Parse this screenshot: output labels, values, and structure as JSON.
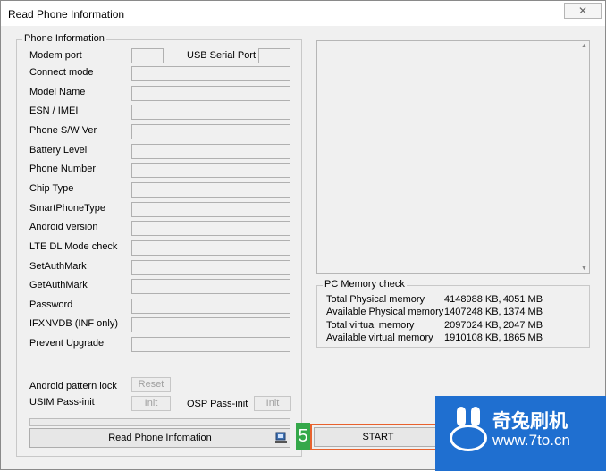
{
  "window": {
    "title": "Read Phone Information",
    "close_glyph": "✕"
  },
  "info_group": {
    "legend": "Phone Information",
    "modem_port_label": "Modem port",
    "usb_serial_port_label": "USB Serial Port",
    "fields": [
      {
        "label": "Connect mode",
        "value": ""
      },
      {
        "label": "Model Name",
        "value": ""
      },
      {
        "label": "ESN / IMEI",
        "value": ""
      },
      {
        "label": "Phone S/W Ver",
        "value": ""
      },
      {
        "label": "Battery Level",
        "value": ""
      },
      {
        "label": "Phone Number",
        "value": ""
      },
      {
        "label": "Chip Type",
        "value": ""
      },
      {
        "label": "SmartPhoneType",
        "value": ""
      },
      {
        "label": "Android version",
        "value": ""
      },
      {
        "label": "LTE DL Mode check",
        "value": ""
      },
      {
        "label": "SetAuthMark",
        "value": ""
      },
      {
        "label": "GetAuthMark",
        "value": ""
      },
      {
        "label": "Password",
        "value": ""
      },
      {
        "label": "IFXNVDB (INF only)",
        "value": ""
      },
      {
        "label": "Prevent Upgrade",
        "value": ""
      }
    ],
    "android_pattern_lock_label": "Android pattern lock",
    "reset_label": "Reset",
    "usim_pass_init_label": "USIM Pass-init",
    "usim_init_label": "Init",
    "osp_pass_init_label": "OSP Pass-init",
    "osp_init_label": "Init"
  },
  "actions": {
    "read_label": "Read Phone Infomation",
    "start_label": "START",
    "step_number": "5"
  },
  "memory": {
    "legend": "PC Memory check",
    "rows": [
      {
        "label": "Total Physical memory",
        "kb": "4148988 KB,",
        "mb": "4051 MB"
      },
      {
        "label": "Available Physical memory",
        "kb": "1407248 KB,",
        "mb": "1374 MB"
      },
      {
        "label": "Total virtual memory",
        "kb": "2097024 KB,",
        "mb": "2047 MB"
      },
      {
        "label": "Available virtual memory",
        "kb": "1910108 KB,",
        "mb": "1865 MB"
      }
    ]
  },
  "watermark": {
    "brand": "奇兔刷机",
    "url": "www.7to.cn"
  },
  "colors": {
    "step_badge": "#35a84a",
    "highlight": "#e8622e",
    "logo_bg": "#1f6fd0"
  }
}
